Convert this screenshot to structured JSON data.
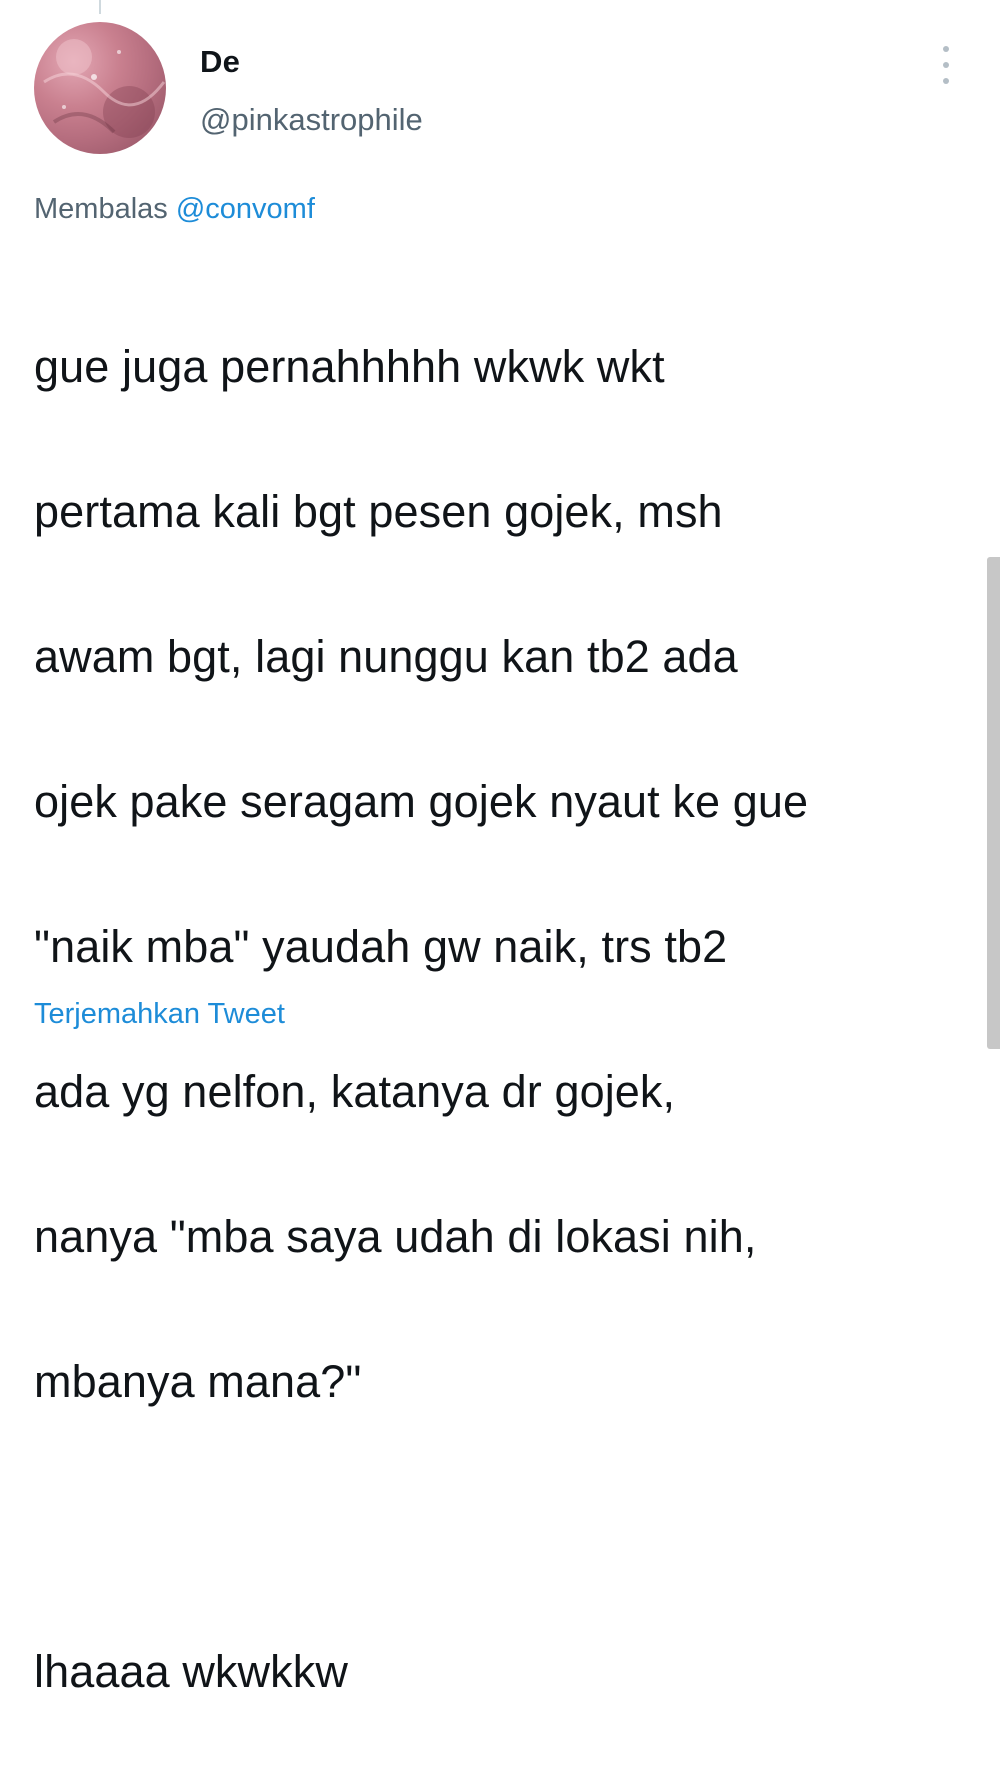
{
  "tweet": {
    "display_name": "De",
    "handle": "@pinkastrophile",
    "reply_prefix": "Membalas",
    "reply_to": "@convomf",
    "text_lines": [
      "gue juga pernahhhhh wkwk wkt",
      "pertama kali bgt pesen gojek, msh",
      "awam bgt, lagi nunggu kan tb2 ada",
      "ojek pake seragam gojek nyaut ke gue",
      "\"naik mba\" yaudah gw naik, trs tb2",
      "ada yg nelfon, katanya dr gojek,",
      "nanya \"mba saya udah di lokasi nih,",
      "mbanya mana?\"",
      "",
      "lhaaaa wkwkkw"
    ],
    "translate_label": "Terjemahkan Tweet"
  },
  "colors": {
    "link": "#1d8cd8",
    "secondary_text": "#536471",
    "primary_text": "#0f1419"
  },
  "icons": {
    "more": "more-vertical-icon"
  }
}
